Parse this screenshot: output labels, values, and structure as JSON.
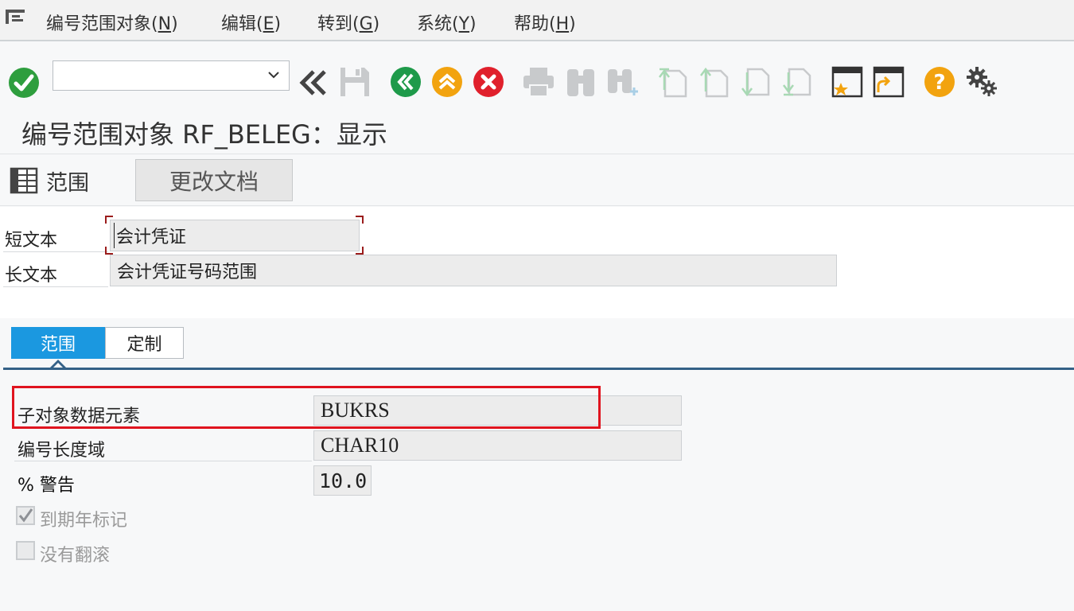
{
  "menu": {
    "items": [
      {
        "text": "编号范围对象(",
        "hot": "N",
        "tail": ")"
      },
      {
        "text": "编辑(",
        "hot": "E",
        "tail": ")"
      },
      {
        "text": "转到(",
        "hot": "G",
        "tail": ")"
      },
      {
        "text": "系统(",
        "hot": "Y",
        "tail": ")"
      },
      {
        "text": "帮助(",
        "hot": "H",
        "tail": ")"
      }
    ]
  },
  "toolbar": {
    "command_value": "",
    "icons": [
      "enter-icon",
      "back-history-icon",
      "save-icon",
      "back-icon",
      "exit-icon",
      "cancel-icon",
      "print-icon",
      "find-icon",
      "find-next-icon",
      "first-page-icon",
      "previous-page-icon",
      "next-page-icon",
      "last-page-icon",
      "create-session-icon",
      "generate-shortcut-icon",
      "help-icon",
      "customize-layout-icon"
    ],
    "colors": {
      "enter": "#2e9e3e",
      "back": "#1e9a4a",
      "exit": "#f2a30f",
      "cancel": "#e0202c",
      "help": "#f2a30f"
    }
  },
  "page": {
    "title": "编号范围对象 RF_BELEG：显示"
  },
  "app_toolbar": {
    "range_label": "范围",
    "change_doc_label": "更改文档"
  },
  "form": {
    "short_text_label": "短文本",
    "short_text_value": "会计凭证",
    "long_text_label": "长文本",
    "long_text_value": "会计凭证号码范围"
  },
  "tabs": [
    {
      "label": "范围",
      "active": true
    },
    {
      "label": "定制",
      "active": false
    }
  ],
  "details": {
    "sub_object_label": "子对象数据元素",
    "sub_object_value": "BUKRS",
    "length_domain_label": "编号长度域",
    "length_domain_value": "CHAR10",
    "warning_label": "% 警告",
    "warning_value": "10.0",
    "year_flag_label": "到期年标记",
    "year_flag_checked": true,
    "no_rollover_label": "没有翻滚",
    "no_rollover_checked": false
  },
  "colors": {
    "accent": "#1b98e0",
    "highlight": "#e0141f",
    "tab_line": "#346187"
  }
}
